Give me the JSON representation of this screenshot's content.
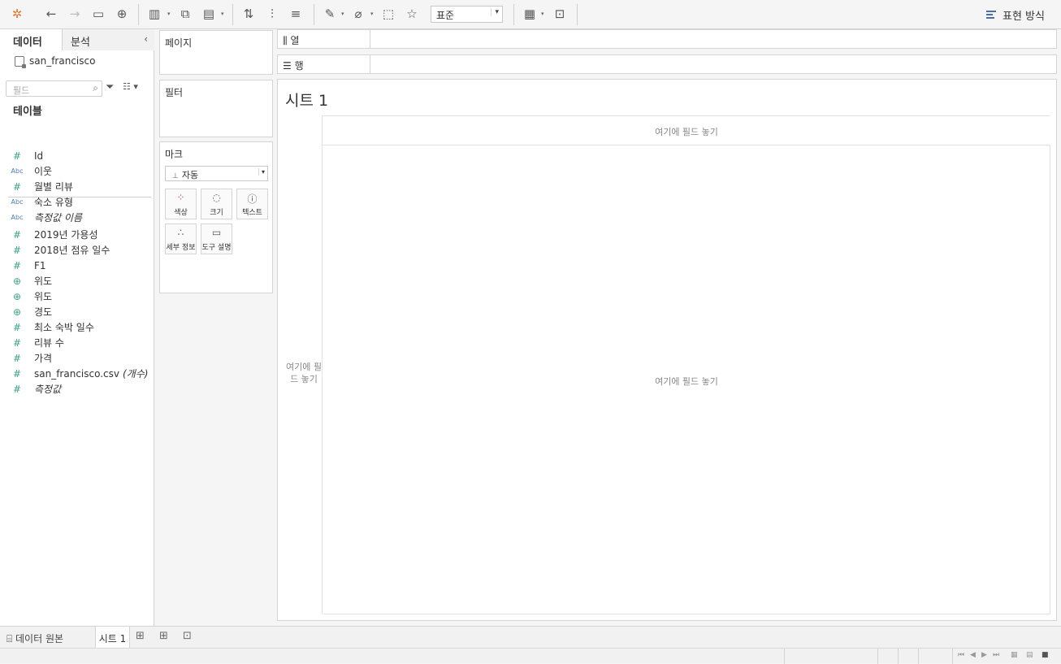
{
  "toolbar": {
    "format_select": "표준",
    "show_me_label": "표현 방식"
  },
  "data_pane": {
    "tab_data": "데이터",
    "tab_analysis": "분석",
    "datasource": "san_francisco",
    "search_placeholder": "필드",
    "tables_heading": "테이블",
    "fields": [
      {
        "type": "num",
        "icon": "#",
        "label": "Id",
        "italic": false
      },
      {
        "type": "abc",
        "icon": "Abc",
        "label": "이웃",
        "italic": false
      },
      {
        "type": "num",
        "icon": "#",
        "label": "월별 리뷰",
        "italic": false
      },
      {
        "type": "abc",
        "icon": "Abc",
        "label": "숙소 유형",
        "italic": false
      },
      {
        "type": "abc",
        "icon": "Abc",
        "label": "측정값 이름",
        "italic": true
      },
      {
        "type": "num",
        "icon": "#",
        "label": "2019년 가용성",
        "italic": false
      },
      {
        "type": "num",
        "icon": "#",
        "label": "2018년 점유 일수",
        "italic": false
      },
      {
        "type": "num",
        "icon": "#",
        "label": "F1",
        "italic": false
      },
      {
        "type": "geo",
        "icon": "⊕",
        "label": "위도",
        "italic": false
      },
      {
        "type": "geo",
        "icon": "⊕",
        "label": "위도",
        "italic": false
      },
      {
        "type": "geo",
        "icon": "⊕",
        "label": "경도",
        "italic": false
      },
      {
        "type": "num",
        "icon": "#",
        "label": "최소 숙박 일수",
        "italic": false
      },
      {
        "type": "num",
        "icon": "#",
        "label": "리뷰 수",
        "italic": false
      },
      {
        "type": "num",
        "icon": "#",
        "label": "가격",
        "italic": false
      },
      {
        "type": "num",
        "icon": "#",
        "label": "san_francisco.csv",
        "suffix": "(개수)",
        "italic": false
      },
      {
        "type": "num",
        "icon": "#",
        "label": "측정값",
        "italic": true
      }
    ]
  },
  "cards": {
    "pages": "페이지",
    "filters": "필터",
    "marks": "마크",
    "mark_type": "자동",
    "mark_buttons": {
      "color": "색상",
      "size": "크기",
      "text": "텍스트",
      "detail": "세부 정보",
      "tooltip": "도구 설명"
    }
  },
  "shelves": {
    "columns": "열",
    "rows": "행"
  },
  "canvas": {
    "title": "시트 1",
    "drop_top": "여기에 필드 놓기",
    "drop_left": "여기에 필드 놓기",
    "drop_main": "여기에 필드 놓기"
  },
  "sheet_tabs": {
    "data_source": "데이터 원본",
    "sheet": "시트 1"
  }
}
